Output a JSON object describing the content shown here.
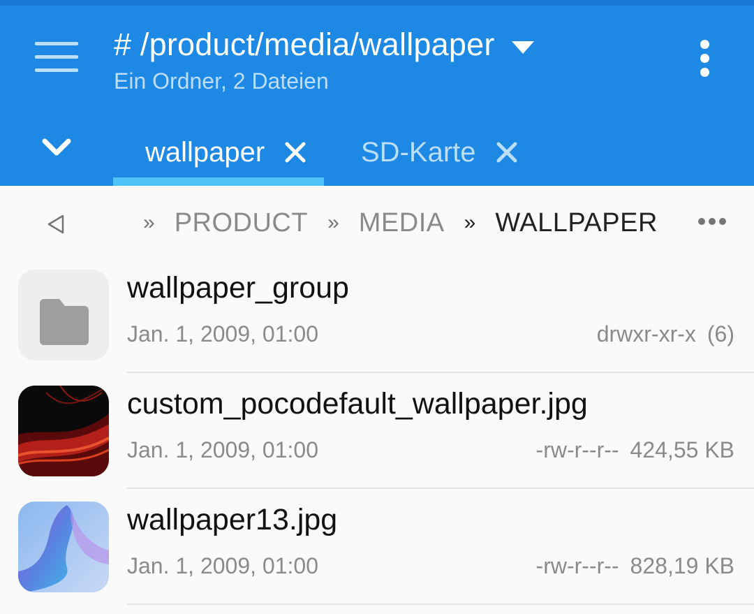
{
  "header": {
    "title": "# /product/media/wallpaper",
    "subtitle": "Ein Ordner, 2 Dateien",
    "background": "#1e88e5"
  },
  "tabs": [
    {
      "label": "wallpaper",
      "active": true
    },
    {
      "label": "SD-Karte",
      "active": false
    }
  ],
  "breadcrumb": {
    "separator": "»",
    "items": [
      "PRODUCT",
      "MEDIA",
      "WALLPAPER"
    ]
  },
  "files": [
    {
      "name": "wallpaper_group",
      "date": "Jan. 1, 2009, 01:00",
      "permissions": "drwxr-xr-x",
      "size": "(6)",
      "icon": "folder-icon"
    },
    {
      "name": "custom_pocodefault_wallpaper.jpg",
      "date": "Jan. 1, 2009, 01:00",
      "permissions": "-rw-r--r--",
      "size": "424,55  KB",
      "icon": "image-thumbnail"
    },
    {
      "name": "wallpaper13.jpg",
      "date": "Jan. 1, 2009, 01:00",
      "permissions": "-rw-r--r--",
      "size": "828,19  KB",
      "icon": "image-thumbnail"
    }
  ]
}
